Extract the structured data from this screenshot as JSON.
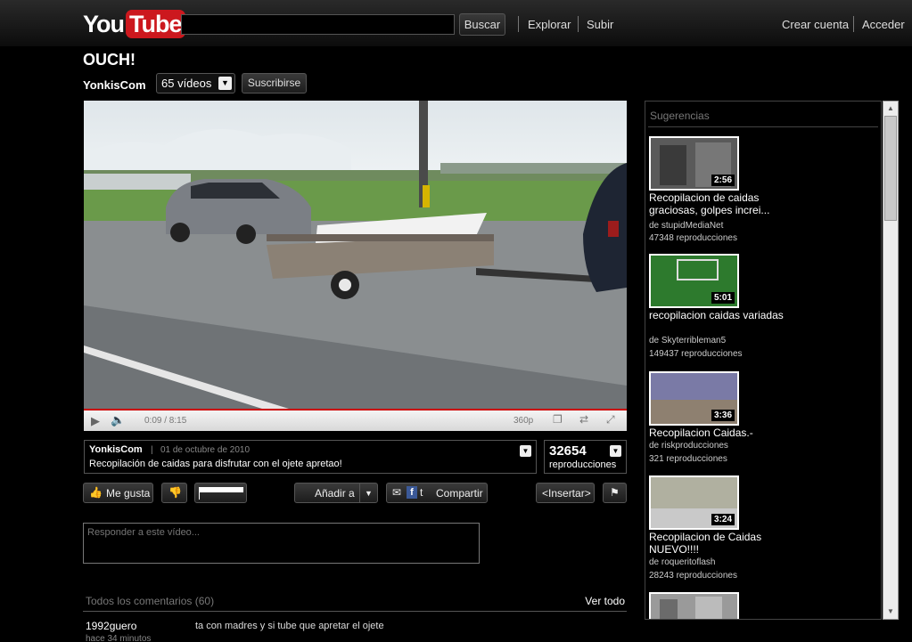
{
  "header": {
    "logo_you": "You",
    "logo_tube": "Tube",
    "search_placeholder": "",
    "search_button": "Buscar",
    "nav": [
      "Explorar",
      "Subir"
    ],
    "create_account": "Crear cuenta",
    "sign_in": "Acceder"
  },
  "video": {
    "title": "OUCH!",
    "channel": "YonkisCom",
    "videos_count": "65 vídeos",
    "subscribe": "Suscribirse",
    "time": "0:09 / 8:15",
    "quality": "360p",
    "progress_fraction": 0.018
  },
  "info": {
    "channel": "YonkisCom",
    "separator": "|",
    "date": "01 de octubre de 2010",
    "description": "Recopilación de caidas para disfrutar con el ojete apretao!",
    "views": "32654",
    "views_label": "reproducciones"
  },
  "actions": {
    "like": "Me gusta",
    "add_to": "Añadir a",
    "share": "Compartir",
    "embed": "<Insertar>"
  },
  "reply_placeholder": "Responder a este vídeo...",
  "comments": {
    "header": "Todos los comentarios (60)",
    "see_all": "Ver todo",
    "items": [
      {
        "user": "1992guero",
        "time": "hace 34 minutos",
        "text": "ta con madres y si tube que apretar el ojete"
      }
    ]
  },
  "suggestions": {
    "header": "Sugerencias",
    "items": [
      {
        "title": "Recopilacion de caidas graciosas, golpes increi...",
        "by": "de stupidMediaNet",
        "views": "47348 reproducciones",
        "duration": "2:56"
      },
      {
        "title": "recopilacion caidas variadas",
        "by": "de Skyterribleman5",
        "views": "149437 reproducciones",
        "duration": "5:01"
      },
      {
        "title": "Recopilacion Caidas.-",
        "by": "de riskproducciones",
        "views": "321 reproducciones",
        "duration": "3:36"
      },
      {
        "title": "Recopilacion de Caidas NUEVO!!!!",
        "by": "de roqueritoflash",
        "views": "28243 reproducciones",
        "duration": "3:24"
      }
    ]
  },
  "colors": {
    "brand_red": "#cc181e",
    "progress": "#cc0000"
  }
}
